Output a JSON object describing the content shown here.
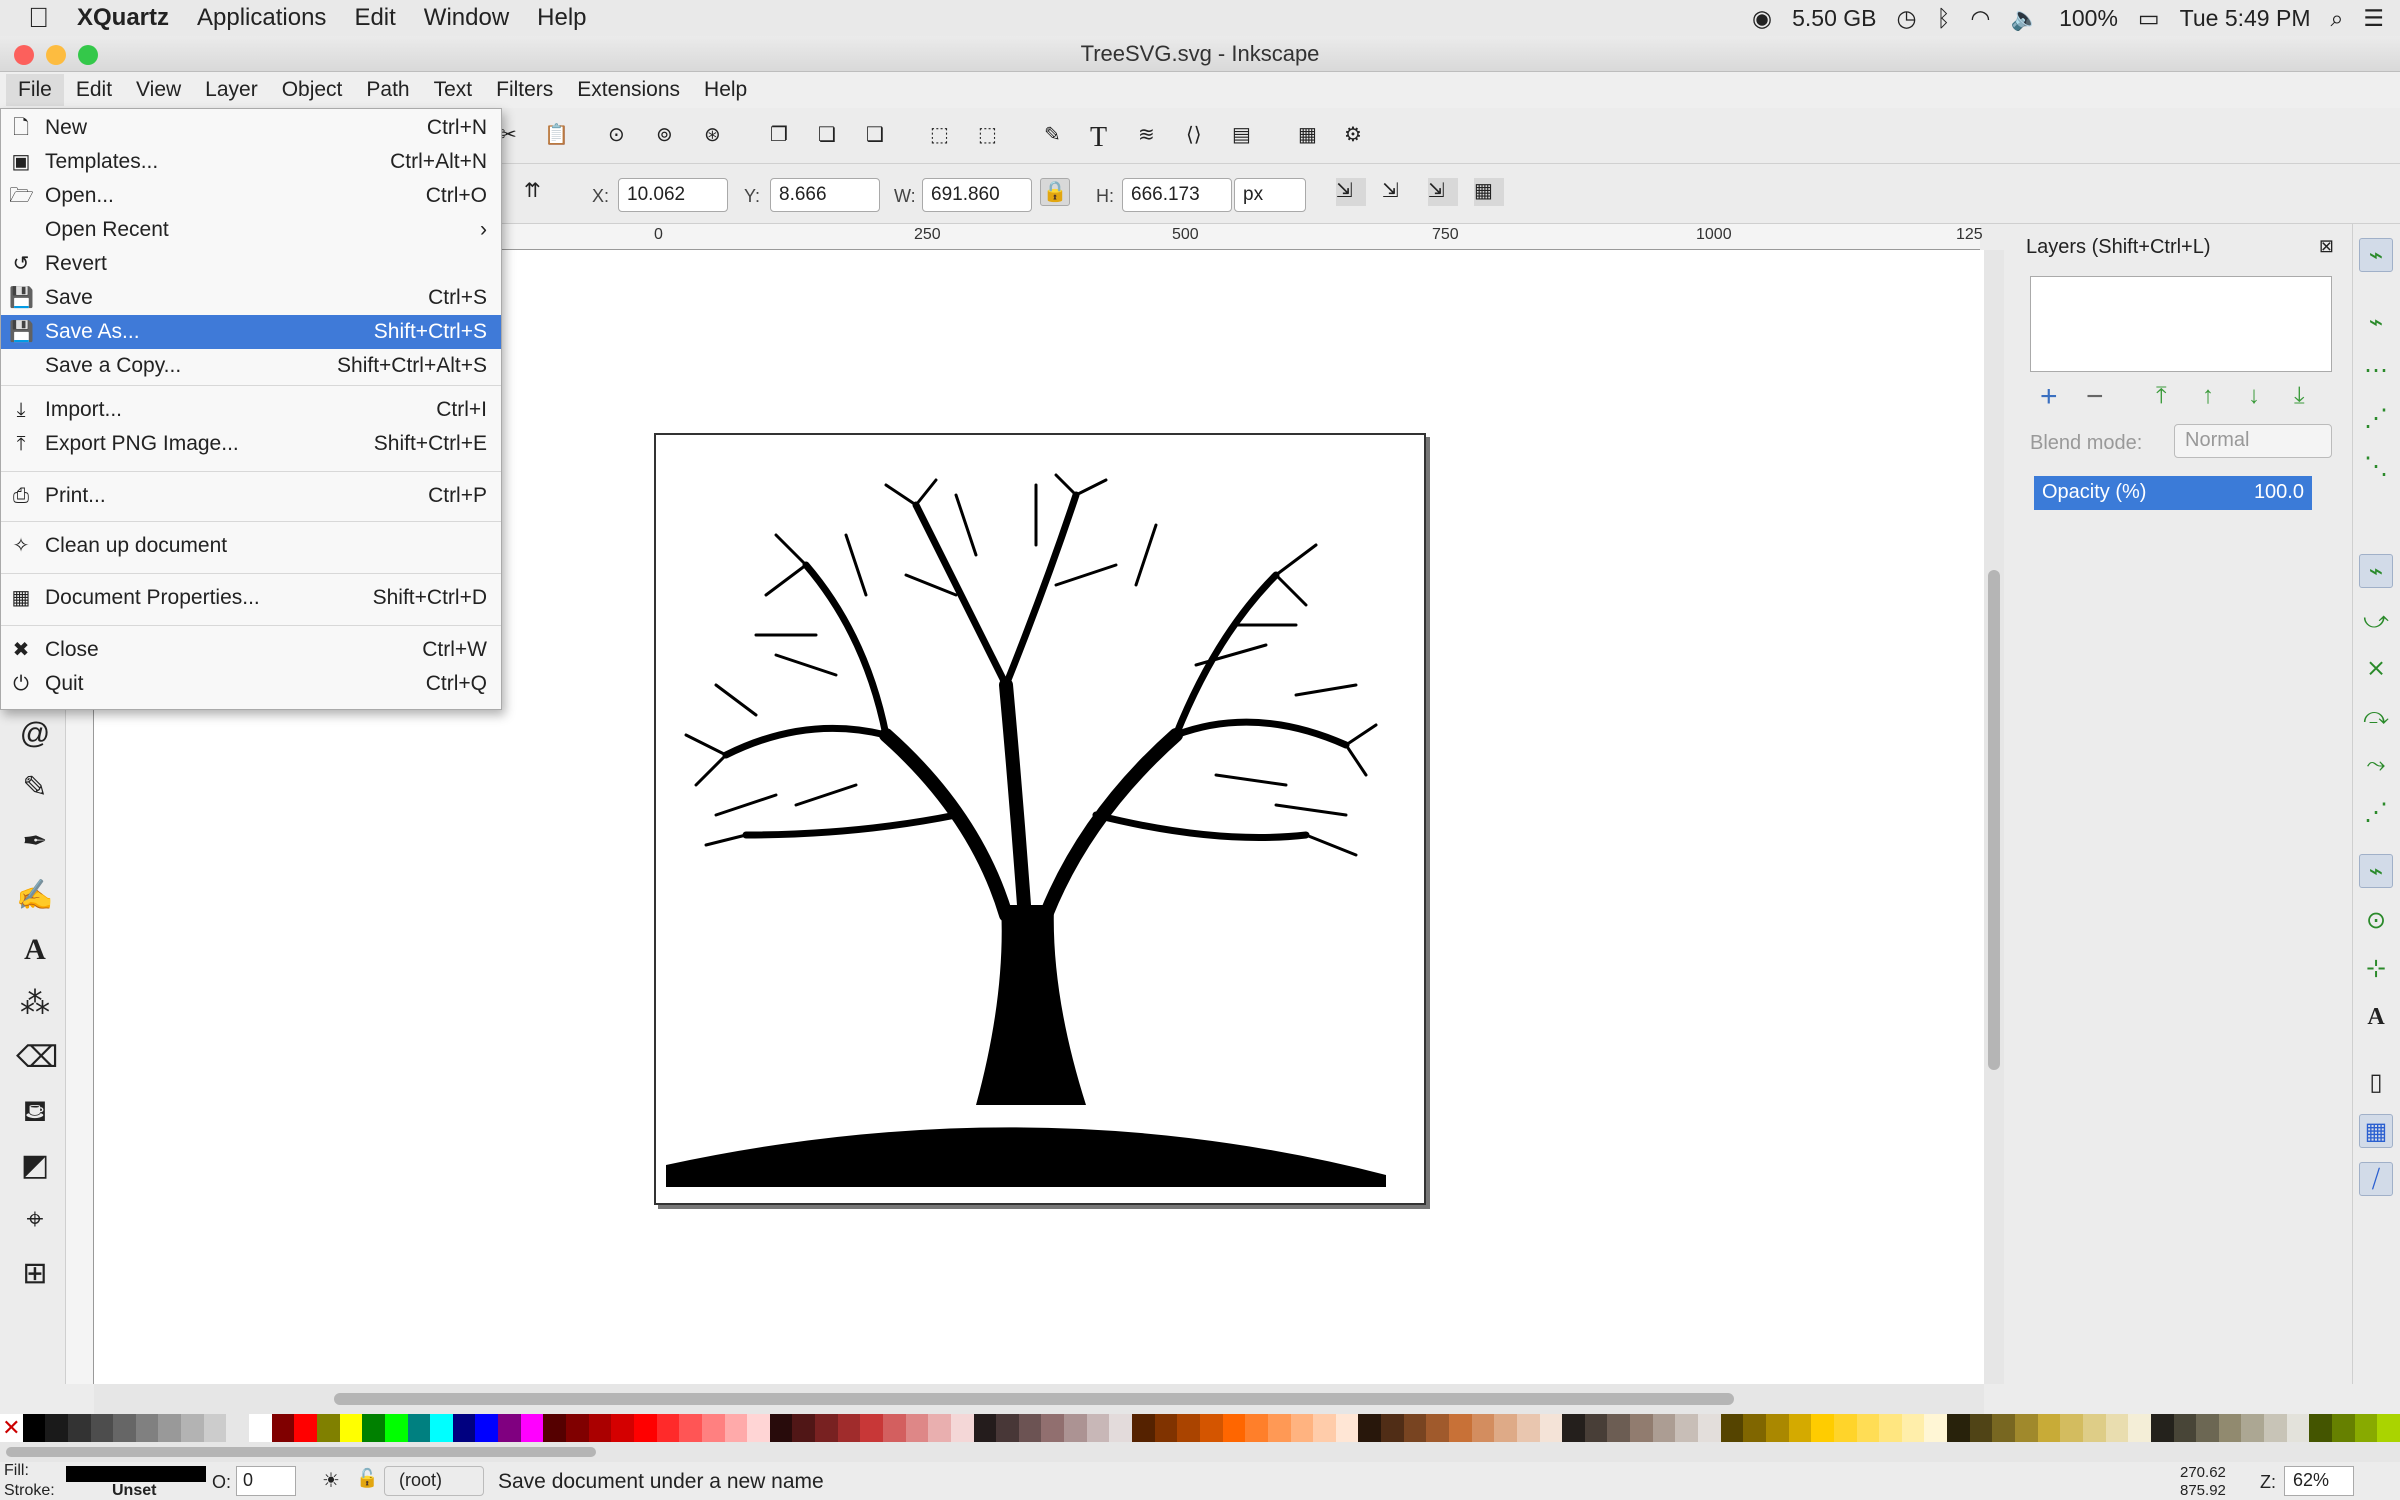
{
  "mac": {
    "app": "XQuartz",
    "menus": [
      "Applications",
      "Edit",
      "Window",
      "Help"
    ],
    "status": {
      "memory": "5.50 GB",
      "battery": "100%",
      "clock": "Tue 5:49 PM"
    }
  },
  "window": {
    "title": "TreeSVG.svg - Inkscape"
  },
  "inkscape_menu": [
    "File",
    "Edit",
    "View",
    "Layer",
    "Object",
    "Path",
    "Text",
    "Filters",
    "Extensions",
    "Help"
  ],
  "coords": {
    "x_label": "X:",
    "x": "10.062",
    "y_label": "Y:",
    "y": "8.666",
    "w_label": "W:",
    "w": "691.860",
    "h_label": "H:",
    "h": "666.173",
    "unit": "px"
  },
  "ruler": {
    "h": [
      "0",
      "250",
      "500",
      "750",
      "1000",
      "125"
    ]
  },
  "file_menu": {
    "items": [
      {
        "label": "New",
        "shortcut": "Ctrl+N",
        "icon": "new-document-icon"
      },
      {
        "label": "Templates...",
        "shortcut": "Ctrl+Alt+N",
        "icon": "templates-icon"
      },
      {
        "label": "Open...",
        "shortcut": "Ctrl+O",
        "icon": "open-folder-icon"
      },
      {
        "label": "Open Recent",
        "shortcut": "›",
        "icon": ""
      },
      {
        "label": "Revert",
        "shortcut": "",
        "icon": "revert-icon"
      },
      {
        "label": "Save",
        "shortcut": "Ctrl+S",
        "icon": "save-icon"
      },
      {
        "label": "Save As...",
        "shortcut": "Shift+Ctrl+S",
        "icon": "save-as-icon"
      },
      {
        "label": "Save a Copy...",
        "shortcut": "Shift+Ctrl+Alt+S",
        "icon": ""
      },
      {
        "label": "Import...",
        "shortcut": "Ctrl+I",
        "icon": "import-icon"
      },
      {
        "label": "Export PNG Image...",
        "shortcut": "Shift+Ctrl+E",
        "icon": "export-icon"
      },
      {
        "label": "Print...",
        "shortcut": "Ctrl+P",
        "icon": "print-icon"
      },
      {
        "label": "Clean up document",
        "shortcut": "",
        "icon": "cleanup-icon"
      },
      {
        "label": "Document Properties...",
        "shortcut": "Shift+Ctrl+D",
        "icon": "document-properties-icon"
      },
      {
        "label": "Close",
        "shortcut": "Ctrl+W",
        "icon": "close-icon"
      },
      {
        "label": "Quit",
        "shortcut": "Ctrl+Q",
        "icon": "quit-icon"
      }
    ],
    "selected": "Save As..."
  },
  "layers_panel": {
    "title": "Layers (Shift+Ctrl+L)",
    "blend_label": "Blend mode:",
    "blend_value": "Normal",
    "opacity_label": "Opacity (%)",
    "opacity_value": "100.0"
  },
  "statusbar": {
    "fill_label": "Fill:",
    "stroke_label": "Stroke:",
    "stroke_value": "Unset",
    "o_label": "O:",
    "o_value": "0",
    "layer": "(root)",
    "message": "Save document under a new name",
    "cursor_x": "270.62",
    "cursor_y": "875.92",
    "zoom_label": "Z:",
    "zoom": "62%"
  },
  "colors": {
    "accent": "#3f7ad8",
    "palette": [
      "#000000",
      "#1a1a1a",
      "#333333",
      "#4d4d4d",
      "#666666",
      "#808080",
      "#999999",
      "#b3b3b3",
      "#cccccc",
      "#e6e6e6",
      "#ffffff",
      "#800000",
      "#ff0000",
      "#808000",
      "#ffff00",
      "#008000",
      "#00ff00",
      "#008080",
      "#00ffff",
      "#000080",
      "#0000ff",
      "#800080",
      "#ff00ff",
      "#550000",
      "#800000",
      "#aa0000",
      "#d40000",
      "#ff0000",
      "#ff2a2a",
      "#ff5555",
      "#ff8080",
      "#ffaaaa",
      "#ffd5d5",
      "#280b0b",
      "#501616",
      "#782121",
      "#a02c2c",
      "#c83737",
      "#d35f5f",
      "#de8787",
      "#e9afaf",
      "#f4d7d7",
      "#241c1c",
      "#483737",
      "#6c5353",
      "#916f6f",
      "#ac9393",
      "#c8b7b7",
      "#e3dbdb",
      "#552200",
      "#803300",
      "#aa4400",
      "#d45500",
      "#ff6600",
      "#ff7f2a",
      "#ff9955",
      "#ffb380",
      "#ffccaa",
      "#ffe6d5",
      "#28170b",
      "#502d16",
      "#784421",
      "#a05a2c",
      "#c87137",
      "#d38d5f",
      "#deaa87",
      "#e9c6af",
      "#f4e3d7",
      "#241f1c",
      "#483e37",
      "#6c5d53",
      "#917c6f",
      "#ac9d93",
      "#c8beb7",
      "#e3dedb",
      "#554400",
      "#806600",
      "#aa8800",
      "#d4aa00",
      "#ffcc00",
      "#ffd42a",
      "#ffdd55",
      "#ffe680",
      "#ffeeaa",
      "#fff6d5",
      "#28220b",
      "#504416",
      "#786721",
      "#a0892c",
      "#c8ab37",
      "#d3bc5f",
      "#decd87",
      "#e9ddaf",
      "#f4eed7",
      "#24221c",
      "#484537",
      "#6c6753",
      "#918a6f",
      "#aca793",
      "#c8c4b7",
      "#e3e2db",
      "#445500",
      "#668000",
      "#88aa00",
      "#aad400"
    ]
  }
}
